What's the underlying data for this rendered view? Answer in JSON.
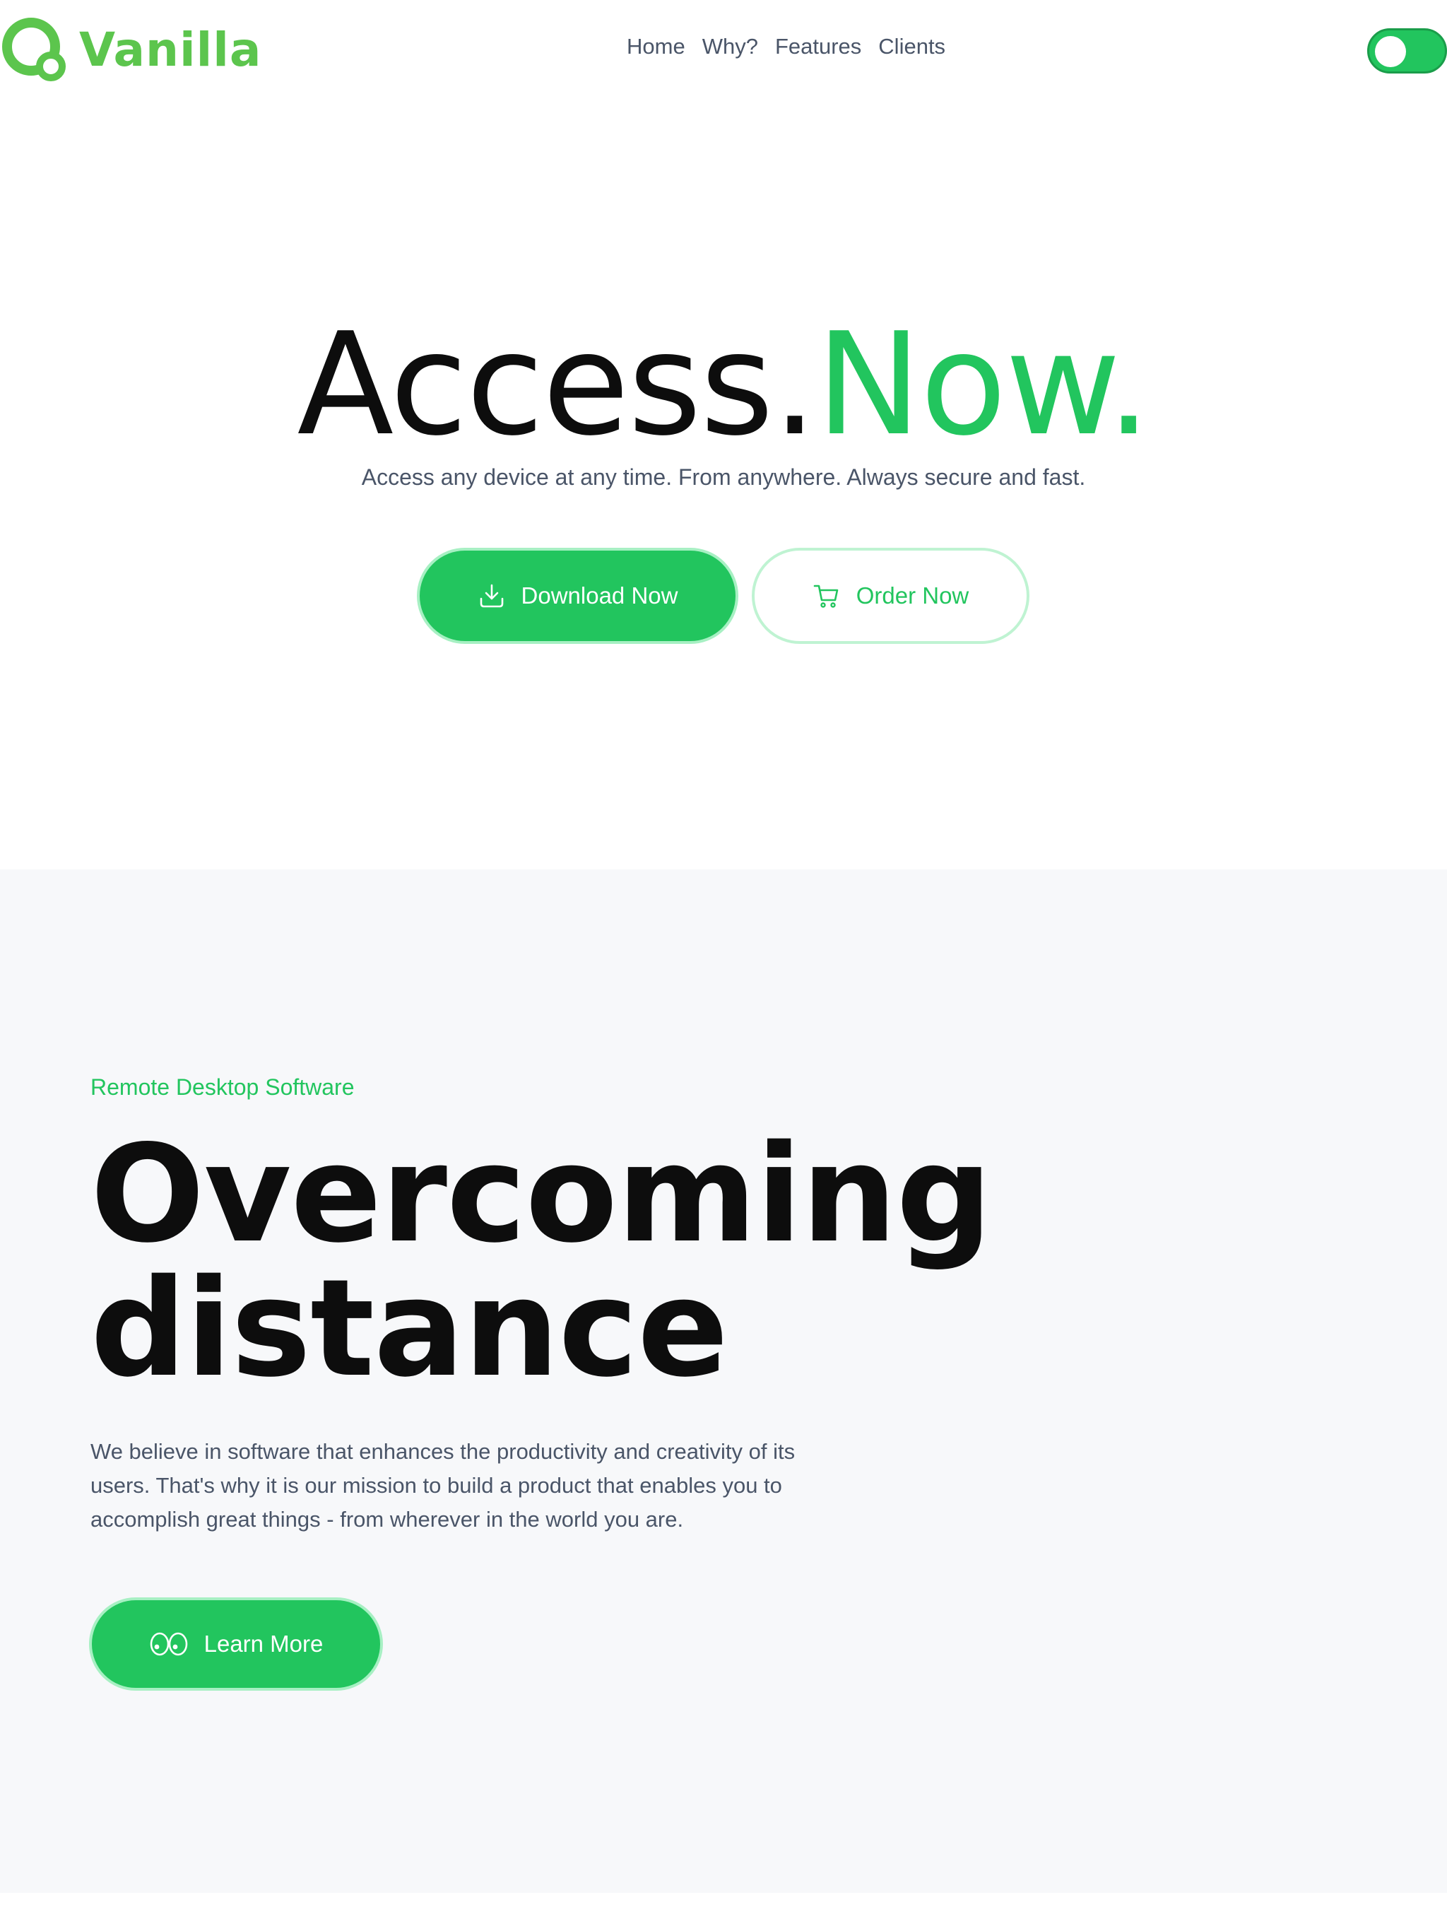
{
  "brand": {
    "name": "Vanilla",
    "color": "#5cc54d",
    "accent": "#22c55e"
  },
  "nav": {
    "items": [
      "Home",
      "Why?",
      "Features",
      "Clients"
    ]
  },
  "theme_toggle": {
    "state": "on"
  },
  "hero": {
    "title_main": "Access.",
    "title_accent": "Now.",
    "subtitle": "Access any device at any time. From anywhere. Always secure and fast.",
    "primary_button": {
      "label": "Download Now",
      "icon": "download-icon"
    },
    "secondary_button": {
      "label": "Order Now",
      "icon": "cart-icon"
    }
  },
  "about": {
    "eyebrow": "Remote Desktop Software",
    "title_line1": "Overcoming",
    "title_line2": "distance",
    "body": "We believe in software that enhances the productivity and creativity of its users. That's why it is our mission to build a product that enables you to accomplish great things - from wherever in the world you are.",
    "button": {
      "label": "Learn More",
      "icon": "eyes-icon"
    }
  }
}
